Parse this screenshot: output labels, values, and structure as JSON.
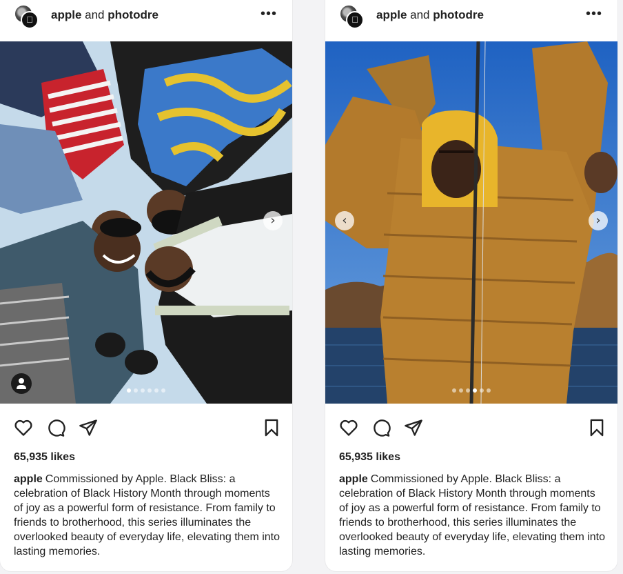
{
  "posts": [
    {
      "header": {
        "account_primary": "apple",
        "joiner": "and",
        "account_secondary": "photodre",
        "more_icon": "more-horizontal-icon",
        "more_glyph": "•••"
      },
      "carousel": {
        "slide_count": 6,
        "active_index": 0,
        "has_prev": false,
        "has_next": true,
        "next_glyph": "›",
        "prev_glyph": "‹",
        "has_user_tag": true
      },
      "actions": {
        "like_icon": "heart-icon",
        "comment_icon": "comment-icon",
        "share_icon": "send-icon",
        "save_icon": "bookmark-icon"
      },
      "likes": "65,935 likes",
      "caption": {
        "user": "apple",
        "text": "Commissioned by Apple. Black Bliss: a celebration of Black History Month through moments of joy as a powerful form of resistance. From family to friends to brotherhood, this series illuminates the overlooked beauty of everyday life, elevating them into lasting memories."
      }
    },
    {
      "header": {
        "account_primary": "apple",
        "joiner": "and",
        "account_secondary": "photodre",
        "more_icon": "more-horizontal-icon",
        "more_glyph": "•••"
      },
      "carousel": {
        "slide_count": 6,
        "active_index": 3,
        "has_prev": true,
        "has_next": true,
        "next_glyph": "›",
        "prev_glyph": "‹",
        "has_user_tag": false
      },
      "actions": {
        "like_icon": "heart-icon",
        "comment_icon": "comment-icon",
        "share_icon": "send-icon",
        "save_icon": "bookmark-icon"
      },
      "likes": "65,935 likes",
      "caption": {
        "user": "apple",
        "text": "Commissioned by Apple. Black Bliss: a celebration of Black History Month through moments of joy as a powerful form of resistance. From family to friends to brotherhood, this series illuminates the overlooked beauty of everyday life, elevating them into lasting memories."
      }
    }
  ],
  "colors": {
    "ice": "#cfe0ee",
    "sky": "#2a6fc7",
    "water": "#23426a",
    "jacket": "#b37a2c",
    "hood": "#e8b52b",
    "text": "#222222"
  }
}
